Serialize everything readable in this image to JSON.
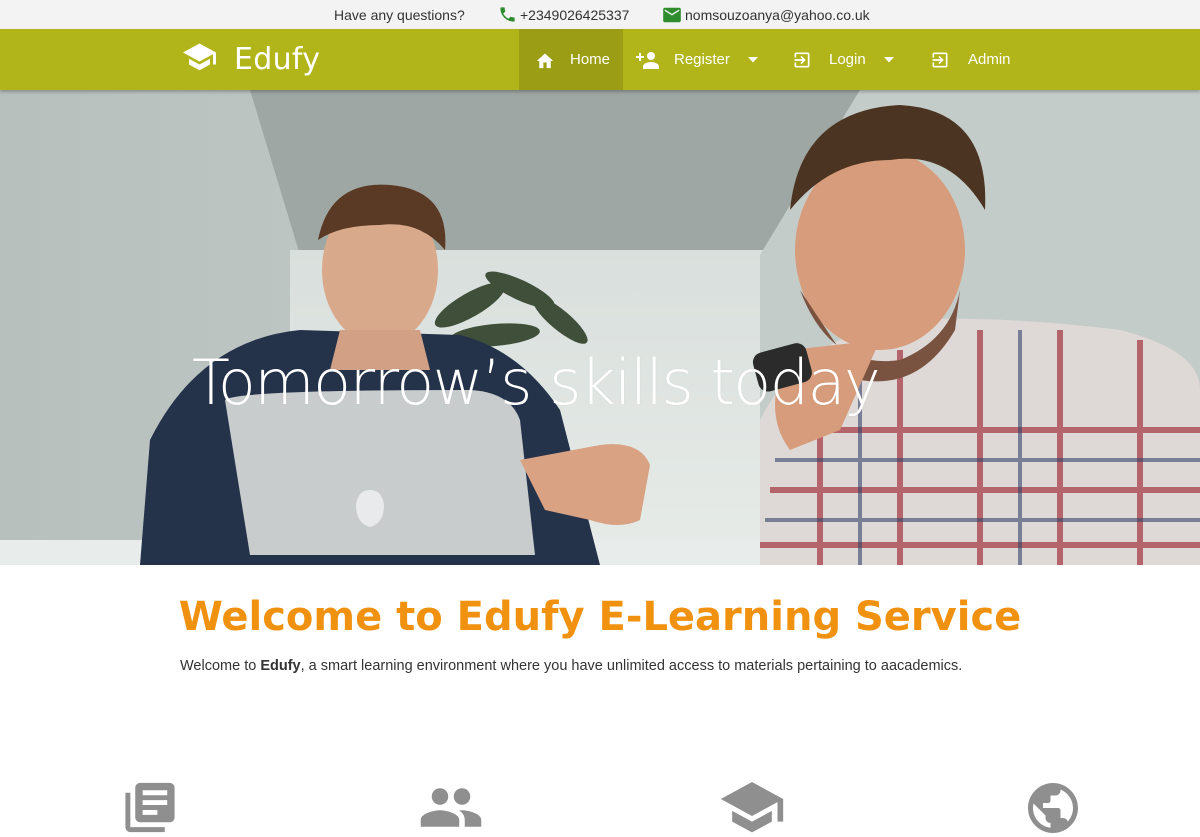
{
  "topbar": {
    "question": "Have any questions?",
    "phone": "+2349026425337",
    "email": "nomsouzoanya@yahoo.co.uk",
    "icon_color": "#2e8b2e"
  },
  "navbar": {
    "brand": "Edufy",
    "brand_icon": "graduation-cap-icon",
    "bg_color": "#b2b51a",
    "items": [
      {
        "label": "Home",
        "icon": "home-icon",
        "active": true
      },
      {
        "label": "Register",
        "icon": "person-add-icon",
        "dropdown": true
      },
      {
        "label": "Login",
        "icon": "login-icon",
        "dropdown": true
      },
      {
        "label": "Admin",
        "icon": "login-icon"
      }
    ]
  },
  "hero": {
    "title": "Tomorrow’s skills today"
  },
  "welcome": {
    "title": "Welcome to Edufy E-Learning Service",
    "text_prefix": "Welcome to ",
    "text_brand": "Edufy",
    "text_suffix": ", a smart learning environment where you have unlimited access to materials pertaining to aacademics.",
    "title_color": "#f0910f"
  },
  "features": {
    "icons": [
      "library-books-icon",
      "people-icon",
      "graduation-cap-icon",
      "globe-icon"
    ],
    "icon_color": "#8f8f8f"
  }
}
